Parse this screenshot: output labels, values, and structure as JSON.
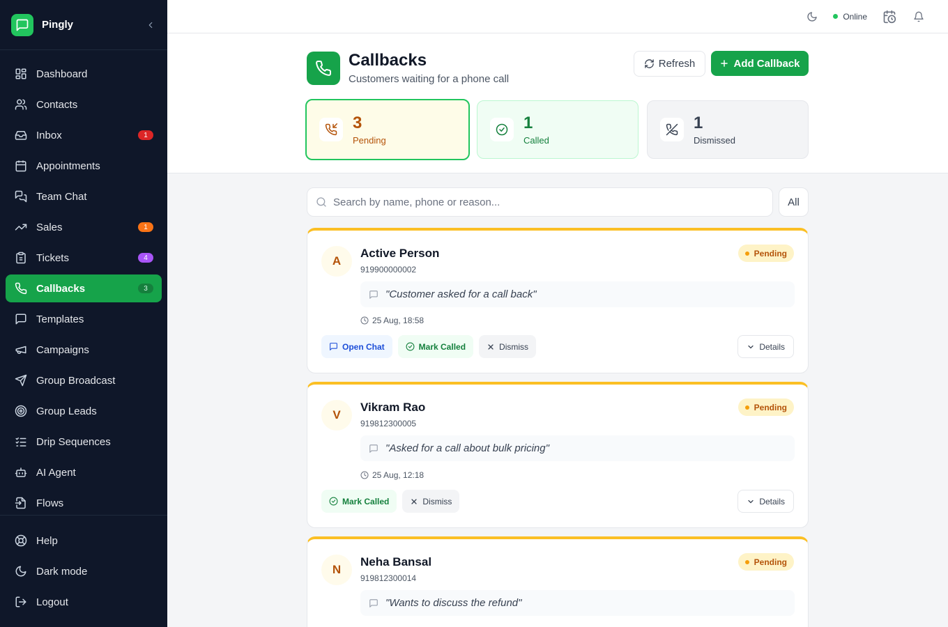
{
  "app": {
    "name": "Pingly"
  },
  "sidebar": {
    "items": [
      {
        "label": "Dashboard",
        "icon": "dashboard-icon"
      },
      {
        "label": "Contacts",
        "icon": "contacts-icon"
      },
      {
        "label": "Inbox",
        "icon": "inbox-icon",
        "badge": "1",
        "badge_color": "#dc2626"
      },
      {
        "label": "Appointments",
        "icon": "calendar-icon"
      },
      {
        "label": "Team Chat",
        "icon": "chat-icon"
      },
      {
        "label": "Sales",
        "icon": "trending-up-icon",
        "badge": "1",
        "badge_color": "#f97316"
      },
      {
        "label": "Tickets",
        "icon": "clipboard-icon",
        "badge": "4",
        "badge_color": "#a855f7"
      },
      {
        "label": "Callbacks",
        "icon": "phone-icon",
        "badge": "3",
        "active": true
      },
      {
        "label": "Templates",
        "icon": "message-square-icon"
      },
      {
        "label": "Campaigns",
        "icon": "megaphone-icon"
      },
      {
        "label": "Group Broadcast",
        "icon": "send-icon"
      },
      {
        "label": "Group Leads",
        "icon": "target-icon"
      },
      {
        "label": "Drip Sequences",
        "icon": "list-checks-icon"
      },
      {
        "label": "AI Agent",
        "icon": "bot-icon"
      },
      {
        "label": "Flows",
        "icon": "flow-icon"
      }
    ],
    "bottom": [
      {
        "label": "Help",
        "icon": "lifebuoy-icon"
      },
      {
        "label": "Dark mode",
        "icon": "moon-icon"
      },
      {
        "label": "Logout",
        "icon": "logout-icon"
      }
    ]
  },
  "topbar": {
    "status": "Online",
    "status_color": "#22c55e"
  },
  "page": {
    "title": "Callbacks",
    "subtitle": "Customers waiting for a phone call",
    "refresh_label": "Refresh",
    "add_label": "Add Callback"
  },
  "stats": {
    "pending": {
      "count": "3",
      "label": "Pending"
    },
    "called": {
      "count": "1",
      "label": "Called"
    },
    "dismissed": {
      "count": "1",
      "label": "Dismissed"
    }
  },
  "search": {
    "placeholder": "Search by name, phone or reason...",
    "value": "",
    "filter": "All"
  },
  "callbacks": [
    {
      "initial": "A",
      "name": "Active Person",
      "phone": "919900000002",
      "status": "Pending",
      "reason": "\"Customer asked for a call back\"",
      "time": "25 Aug, 18:58",
      "actions": {
        "open_chat": "Open Chat",
        "mark_called": "Mark Called",
        "dismiss": "Dismiss"
      },
      "details": "Details"
    },
    {
      "initial": "V",
      "name": "Vikram Rao",
      "phone": "919812300005",
      "status": "Pending",
      "reason": "\"Asked for a call about bulk pricing\"",
      "time": "25 Aug, 12:18",
      "actions": {
        "mark_called": "Mark Called",
        "dismiss": "Dismiss"
      },
      "details": "Details"
    },
    {
      "initial": "N",
      "name": "Neha Bansal",
      "phone": "919812300014",
      "status": "Pending",
      "reason": "\"Wants to discuss the refund\""
    }
  ],
  "colors": {
    "brand": "#16a34a",
    "pending": "#fbbf24",
    "sidebar_bg": "#0f1729"
  }
}
